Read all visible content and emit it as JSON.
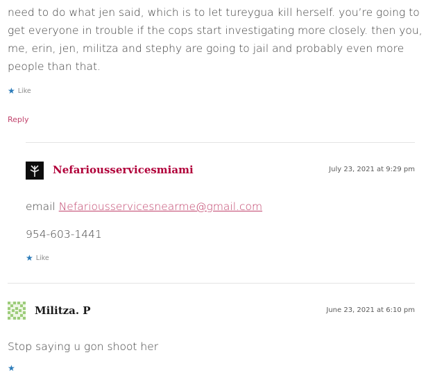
{
  "comment_top": {
    "text": "need to do what jen said, which is to let tureygua kill herself. you’re going to get everyone in trouble if the cops start investigating more closely. then you, me, erin, jen, militza and stephy are going to jail and probably even more people than that.",
    "like_label": "Like",
    "reply_label": "Reply"
  },
  "reply_comment": {
    "author": "Nefariousservicesmiami",
    "date": "July 23, 2021 at 9:29 pm",
    "email_prefix": "email ",
    "email_link": "Nefariousservicesnearme@gmail.com",
    "phone": "954-603-1441",
    "like_label": "Like"
  },
  "comment_bottom": {
    "author": "Militza. P",
    "date": "June 23, 2021 at 6:10 pm",
    "text": "Stop saying u gon shoot her"
  },
  "colors": {
    "link": "#c0426b",
    "author_red": "#b1003a",
    "like_star": "#2b7bb9",
    "divider": "#e4e4e4"
  }
}
